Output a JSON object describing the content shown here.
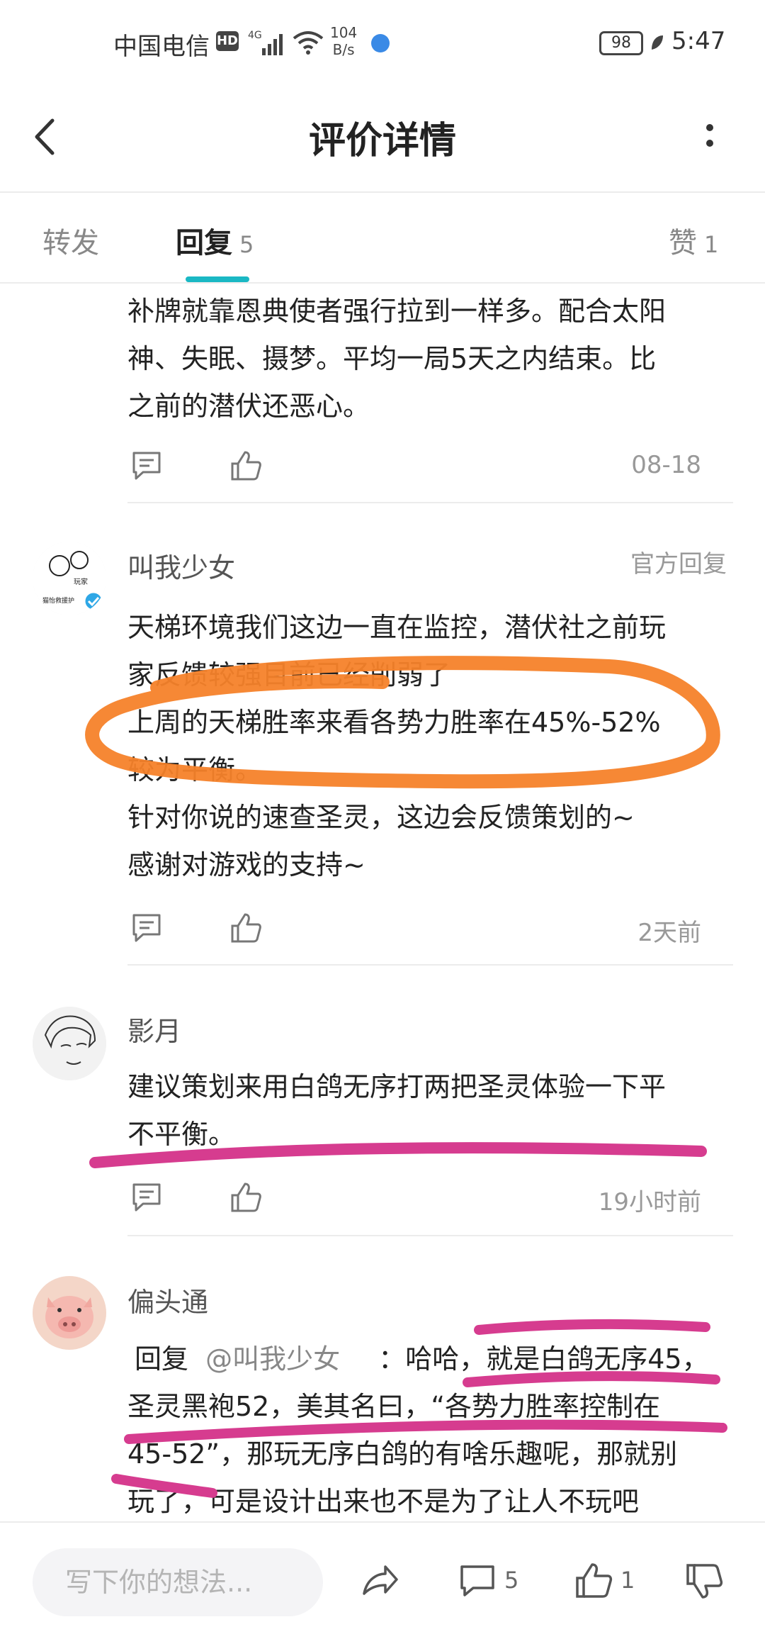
{
  "status": {
    "carrier": "中国电信",
    "hd": "HD",
    "net": "4G",
    "speed_top": "104",
    "speed_unit": "B/s",
    "battery": "98",
    "time": "5:47"
  },
  "header": {
    "title": "评价详情"
  },
  "tabs": [
    {
      "label": "转发",
      "count": ""
    },
    {
      "label": "回复",
      "count": "5"
    },
    {
      "label": "赞",
      "count": "1"
    }
  ],
  "comments": [
    {
      "lines": [
        "补牌就靠恩典使者强行拉到一样多。配合太阳",
        "神、失眠、摄梦。平均一局5天之内结束。比",
        "之前的潜伏还恶心。"
      ],
      "time": "08-18"
    },
    {
      "user": "叫我少女",
      "tag": "官方回复",
      "avatar_text": [
        "玩家",
        "猫怡救援护"
      ],
      "lines": [
        "天梯环境我们这边一直在监控，潜伏社之前玩",
        "家反馈较强目前已经削弱了",
        "上周的天梯胜率来看各势力胜率在45%-52%",
        "较为平衡。",
        "针对你说的速查圣灵，这边会反馈策划的~",
        "感谢对游戏的支持~"
      ],
      "time": "2天前"
    },
    {
      "user": "影月",
      "lines": [
        "建议策划来用白鸽无序打两把圣灵体验一下平",
        "不平衡。"
      ],
      "time": "19小时前"
    },
    {
      "user": "偏头通",
      "reply_prefix": "回复",
      "mention": "@叫我少女",
      "first_line_rest": "：哈哈，就是白鸽无序45，",
      "lines": [
        "圣灵黑袍52，美其名曰，“各势力胜率控制在",
        "45-52”，那玩无序白鸽的有啥乐趣呢，那就别",
        "玩了，可是设计出来也不是为了让人不玩吧"
      ]
    }
  ],
  "bottom": {
    "placeholder": "写下你的想法...",
    "comment_count": "5",
    "like_count": "1"
  },
  "colors": {
    "accent": "#1ab8c4",
    "orange_mark": "#f5822a",
    "pink_mark": "#d63c8f"
  }
}
